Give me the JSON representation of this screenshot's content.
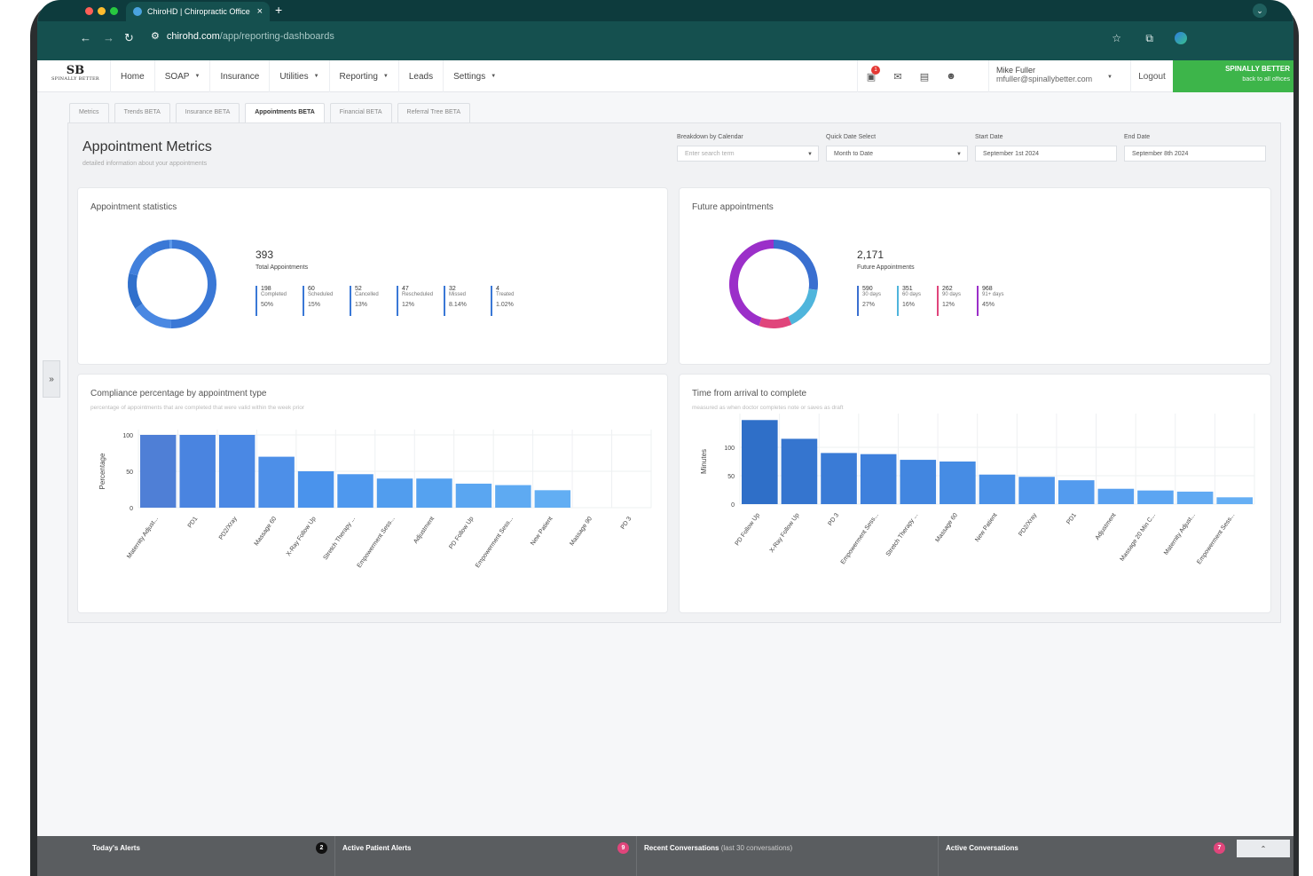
{
  "browser": {
    "tab_title": "ChiroHD | Chiropractic Office",
    "url_host": "chirohd.com",
    "url_path": "/app/reporting-dashboards"
  },
  "header": {
    "logo_initials": "SB",
    "logo_text": "SPINALLY BETTER",
    "menu": [
      {
        "label": "Home",
        "dropdown": false
      },
      {
        "label": "SOAP",
        "dropdown": true
      },
      {
        "label": "Insurance",
        "dropdown": false
      },
      {
        "label": "Utilities",
        "dropdown": true
      },
      {
        "label": "Reporting",
        "dropdown": true
      },
      {
        "label": "Leads",
        "dropdown": false
      },
      {
        "label": "Settings",
        "dropdown": true
      }
    ],
    "notification_count": "1",
    "user_name": "Mike Fuller",
    "user_email": "mfuller@spinallybetter.com",
    "logout": "Logout",
    "brand_name": "SPINALLY BETTER",
    "brand_link": "back to all offices"
  },
  "subtabs": [
    "Metrics",
    "Trends BETA",
    "Insurance BETA",
    "Appointments BETA",
    "Financial BETA",
    "Referral Tree BETA"
  ],
  "active_subtab": "Appointments BETA",
  "page": {
    "title": "Appointment Metrics",
    "subtitle": "detailed information about your appointments"
  },
  "filters": {
    "breakdown_label": "Breakdown by Calendar",
    "breakdown_placeholder": "Enter search term",
    "quick_label": "Quick Date Select",
    "quick_value": "Month to Date",
    "start_label": "Start Date",
    "start_value": "September 1st 2024",
    "end_label": "End Date",
    "end_value": "September 8th 2024"
  },
  "appointment_stats": {
    "title": "Appointment statistics",
    "total": "393",
    "total_label": "Total Appointments",
    "stats": [
      {
        "value": "198",
        "label": "Completed",
        "pct": "50%",
        "color": "#3a78d6"
      },
      {
        "value": "60",
        "label": "Scheduled",
        "pct": "15%",
        "color": "#3a78d6"
      },
      {
        "value": "52",
        "label": "Cancelled",
        "pct": "13%",
        "color": "#3a78d6"
      },
      {
        "value": "47",
        "label": "Rescheduled",
        "pct": "12%",
        "color": "#3a78d6"
      },
      {
        "value": "32",
        "label": "Missed",
        "pct": "8.14%",
        "color": "#3a78d6"
      },
      {
        "value": "4",
        "label": "Treated",
        "pct": "1.02%",
        "color": "#3a78d6"
      }
    ]
  },
  "future_appointments": {
    "title": "Future appointments",
    "total": "2,171",
    "total_label": "Future Appointments",
    "stats": [
      {
        "value": "590",
        "label": "30 days",
        "pct": "27%",
        "color": "#3a6fd0"
      },
      {
        "value": "351",
        "label": "60 days",
        "pct": "16%",
        "color": "#4fb5dc"
      },
      {
        "value": "262",
        "label": "90 days",
        "pct": "12%",
        "color": "#e0457b"
      },
      {
        "value": "968",
        "label": "91+ days",
        "pct": "45%",
        "color": "#9b2fc9"
      }
    ]
  },
  "chart_data": [
    {
      "type": "bar",
      "title": "Compliance percentage by appointment type",
      "subtitle": "percentage of appointments that are completed that were valid within the week prior",
      "ylabel": "Percentage",
      "ylim": [
        0,
        100
      ],
      "yticks": [
        0,
        50,
        100
      ],
      "categories": [
        "Maternity Adjust...",
        "PD1",
        "PD2/Xray",
        "Massage 60",
        "X-Ray Follow Up",
        "Stretch Therapy ...",
        "Empowerment Sess...",
        "Adjustment",
        "PD Follow Up",
        "Empowerment Sess...",
        "New Patient",
        "Massage 90",
        "PD 3"
      ],
      "values": [
        100,
        100,
        100,
        70,
        50,
        46,
        40,
        40,
        33,
        31,
        24,
        0,
        0
      ]
    },
    {
      "type": "bar",
      "title": "Time from arrival to complete",
      "subtitle": "measured as when doctor completes note or saves as draft",
      "ylabel": "Minutes",
      "ylim": [
        0,
        150
      ],
      "yticks": [
        0,
        50,
        100
      ],
      "categories": [
        "PD Follow Up",
        "X-Ray Follow Up",
        "PD 3",
        "Empowerment Sess...",
        "Stretch Therapy ...",
        "Massage 60",
        "New Patient",
        "PD2/Xray",
        "PD1",
        "Adjustment",
        "Massage 20 Min C...",
        "Maternity Adjust...",
        "Empowerment Sess..."
      ],
      "values": [
        148,
        115,
        90,
        88,
        78,
        75,
        52,
        48,
        42,
        27,
        24,
        22,
        12
      ]
    }
  ],
  "bottom_bar": {
    "todays_alerts": "Today's Alerts",
    "todays_alerts_count": "2",
    "active_patient_alerts": "Active Patient Alerts",
    "active_patient_alerts_count": "9",
    "recent_conversations": "Recent Conversations",
    "recent_conversations_sub": "(last 30 conversations)",
    "active_conversations": "Active Conversations",
    "active_conversations_count": "7"
  },
  "colors": {
    "brand_green": "#3db54a",
    "chrome_teal": "#15504f",
    "bar_blue": "#3f86e0"
  }
}
